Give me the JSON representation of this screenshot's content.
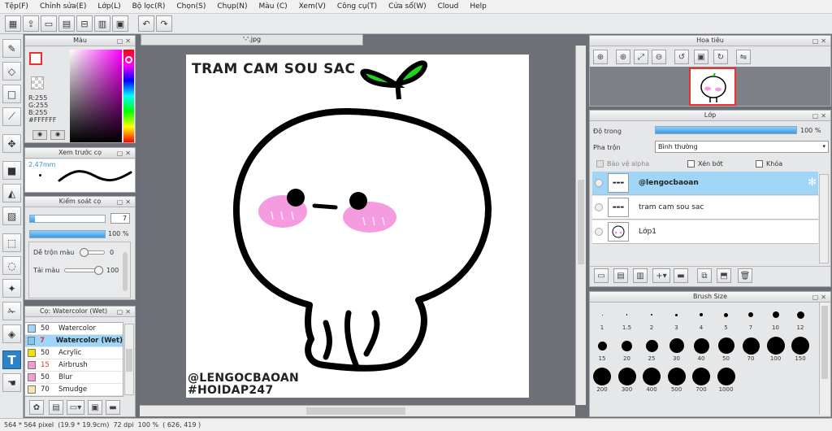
{
  "menu": [
    "Tệp(F)",
    "Chỉnh sửa(E)",
    "Lớp(L)",
    "Bộ lọc(R)",
    "Chọn(S)",
    "Chụp(N)",
    "Màu (C)",
    "Xem(V)",
    "Công cụ(T)",
    "Cửa sổ(W)",
    "Cloud",
    "Help"
  ],
  "toolbar_icons": [
    "layout-icon",
    "new-file-icon",
    "open-icon",
    "save-icon",
    "export-icon",
    "panel-icon",
    "print-icon",
    "undo-icon",
    "redo-icon"
  ],
  "tools_icons": [
    "pen-icon",
    "eraser-icon",
    "rect-select-icon",
    "line-icon",
    "move-icon",
    "fill-rect-icon",
    "bucket-icon",
    "gradient-icon",
    "select-icon",
    "lasso-icon",
    "magic-wand-icon",
    "scissor-icon",
    "eraser2-icon",
    "text-icon",
    "hand-icon"
  ],
  "color_panel": {
    "title": "Màu",
    "r": "R:255",
    "g": "G:255",
    "b": "B:255",
    "hex": "#FFFFFF",
    "foreground": "#ffffff",
    "accent": "#e8322e"
  },
  "preview_panel": {
    "title": "Xem trước cọ",
    "size": "2.47mm"
  },
  "brush_control": {
    "title": "Kiểm soát cọ",
    "size_value": "7",
    "size_fraction": 0.07,
    "opacity_value": "100 %",
    "blend_label": "Dễ trộn màu",
    "blend_value": "0",
    "paint_label": "Tải màu",
    "paint_value": "100"
  },
  "brush_list": {
    "title": "Cọ: Watercolor (Wet)",
    "items": [
      {
        "size": "50",
        "name": "Watercolor",
        "color": "#9fd6f7"
      },
      {
        "size": "7",
        "name": "Watercolor (Wet)",
        "color": "#7fc7f5"
      },
      {
        "size": "50",
        "name": "Acrylic",
        "color": "#f1e200"
      },
      {
        "size": "15",
        "name": "Airbrush",
        "color": "#f29cd1"
      },
      {
        "size": "50",
        "name": "Blur",
        "color": "#f29cd1"
      },
      {
        "size": "70",
        "name": "Smudge",
        "color": "#f7e7a6"
      }
    ]
  },
  "document": {
    "tab": "'-'.jpg",
    "drawing_title": "TRAM CAM SOU SAC",
    "credit1": "@LENGOCBAOAN",
    "credit2": "#HOIDAP247"
  },
  "navigator": {
    "title": "Hoa tiêu"
  },
  "layer_panel": {
    "title": "Lớp",
    "opacity_label": "Độ trong",
    "opacity_value": "100 %",
    "opacity_fraction": 1.0,
    "blend_label": "Pha trộn",
    "blend_mode": "Bình thường",
    "protect_alpha": "Bảo vệ alpha",
    "clipping": "Xén bớt",
    "lock": "Khóa",
    "layers": [
      {
        "name": "@lengocbaoan",
        "selected": true
      },
      {
        "name": "tram cam sou sac",
        "selected": false
      },
      {
        "name": "Lớp1",
        "selected": false
      }
    ]
  },
  "brush_size": {
    "title": "Brush Size",
    "sizes": [
      "1",
      "1.5",
      "2",
      "3",
      "4",
      "5",
      "7",
      "10",
      "12",
      "15",
      "20",
      "25",
      "30",
      "40",
      "50",
      "70",
      "100",
      "150",
      "200",
      "300",
      "400",
      "500",
      "700",
      "1000"
    ]
  },
  "status": {
    "size": "564 * 564 pixel",
    "physical": "(19.9 * 19.9cm)",
    "dpi": "72 dpi",
    "zoom": "100 %",
    "coords": "( 626, 419 )"
  }
}
